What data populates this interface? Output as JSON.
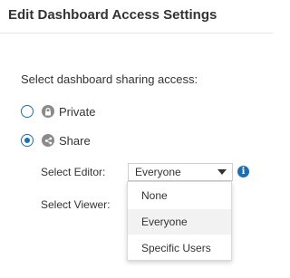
{
  "dialog": {
    "title": "Edit Dashboard Access Settings",
    "prompt": "Select dashboard sharing access:"
  },
  "options": [
    {
      "label": "Private",
      "icon": "lock-icon",
      "selected": false
    },
    {
      "label": "Share",
      "icon": "share-icon",
      "selected": true
    }
  ],
  "editor": {
    "label": "Select Editor:",
    "value": "Everyone",
    "info_icon": "info-icon"
  },
  "viewer": {
    "label": "Select Viewer:"
  },
  "dropdown": {
    "items": [
      "None",
      "Everyone",
      "Specific Users"
    ],
    "highlighted": "Everyone"
  },
  "colors": {
    "accent": "#1a6fb5",
    "icon_gray": "#8a8a8a",
    "text": "#333333"
  }
}
